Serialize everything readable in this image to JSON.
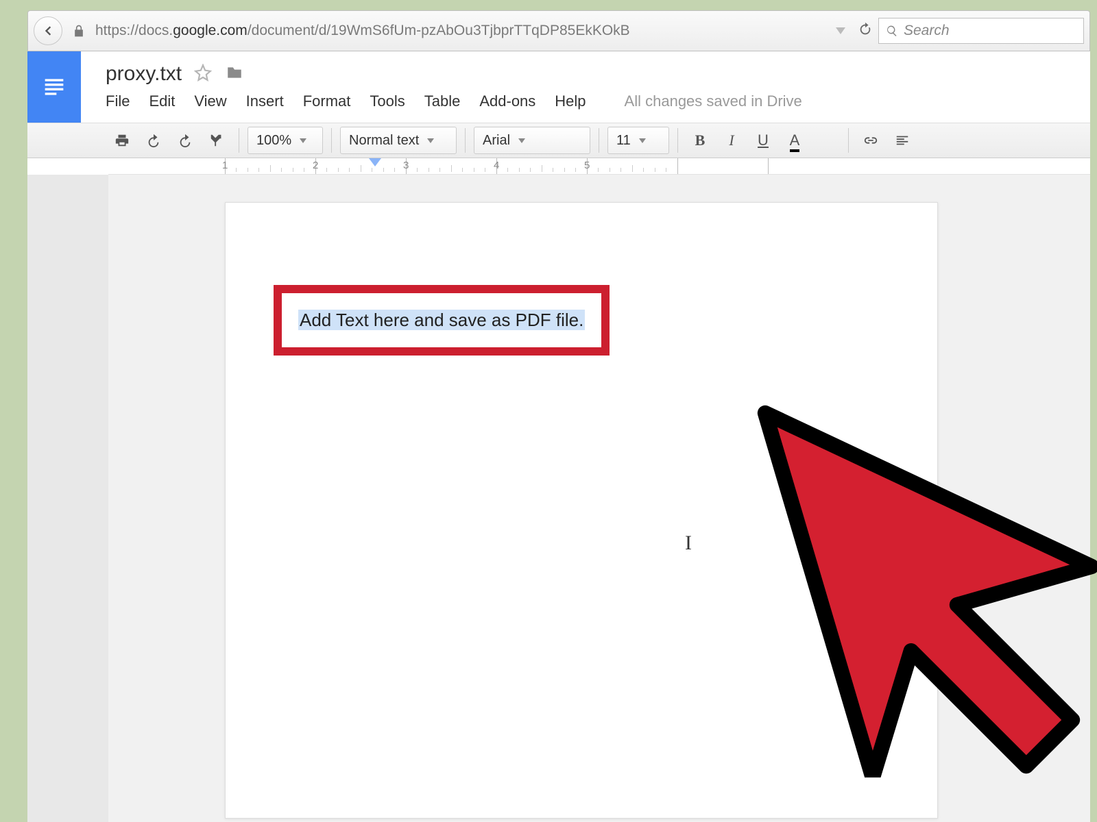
{
  "browser": {
    "url_prefix": "https://docs.",
    "url_domain": "google.com",
    "url_suffix": "/document/d/19WmS6fUm-pzAbOu3TjbprTTqDP85EkKOkB",
    "search_placeholder": "Search"
  },
  "doc": {
    "title": "proxy.txt",
    "content": "Add Text here and save as PDF file."
  },
  "menus": [
    "File",
    "Edit",
    "View",
    "Insert",
    "Format",
    "Tools",
    "Table",
    "Add-ons",
    "Help"
  ],
  "save_status": "All changes saved in Drive",
  "toolbar": {
    "zoom": "100%",
    "style": "Normal text",
    "font": "Arial",
    "size": "11",
    "bold": "B",
    "italic": "I",
    "underline": "U",
    "textcolor": "A"
  },
  "ruler_numbers": [
    "1",
    "2",
    "3",
    "4",
    "5"
  ]
}
